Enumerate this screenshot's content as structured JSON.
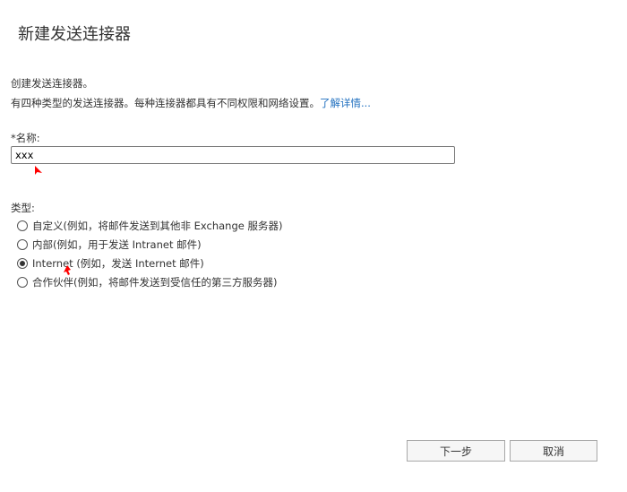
{
  "dialog": {
    "title": "新建发送连接器",
    "description_line1": "创建发送连接器。",
    "description_line2": "有四种类型的发送连接器。每种连接器都具有不同权限和网络设置。",
    "learn_more_link": "了解详情..."
  },
  "name_field": {
    "label": "*名称:",
    "value": "xxx"
  },
  "type": {
    "label": "类型:",
    "selected": "internet",
    "options": [
      {
        "id": "custom",
        "label": "自定义(例如，将邮件发送到其他非 Exchange 服务器)",
        "checked": false
      },
      {
        "id": "internal",
        "label": "内部(例如，用于发送 Intranet 邮件)",
        "checked": false
      },
      {
        "id": "internet",
        "label": "Internet (例如，发送 Internet 邮件)",
        "checked": true
      },
      {
        "id": "partner",
        "label": "合作伙伴(例如，将邮件发送到受信任的第三方服务器)",
        "checked": false
      }
    ]
  },
  "buttons": {
    "next_label": "下一步",
    "cancel_label": "取消"
  },
  "colors": {
    "link": "#1f6fbf",
    "annotation_marker": "#ff0000"
  }
}
